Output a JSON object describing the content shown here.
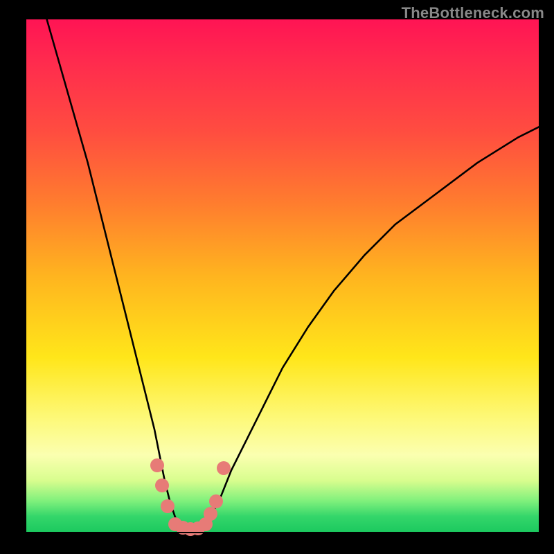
{
  "watermark": "TheBottleneck.com",
  "colors": {
    "curve": "#000000",
    "dot": "#e77b77",
    "plot_border": "#000000"
  },
  "chart_data": {
    "type": "line",
    "title": "",
    "xlabel": "",
    "ylabel": "",
    "xlim": [
      0,
      100
    ],
    "ylim": [
      0,
      100
    ],
    "grid": false,
    "legend": false,
    "series": [
      {
        "name": "bottleneck-curve",
        "x": [
          4,
          6,
          8,
          10,
          12,
          14,
          16,
          18,
          20,
          22,
          24,
          25,
          26,
          27,
          28,
          29,
          30,
          31,
          32,
          33,
          34,
          36,
          38,
          40,
          43,
          46,
          50,
          55,
          60,
          66,
          72,
          80,
          88,
          96,
          100
        ],
        "y": [
          100,
          93,
          86,
          79,
          72,
          64,
          56,
          48,
          40,
          32,
          24,
          20,
          15,
          10,
          6,
          3,
          1,
          0.6,
          0.5,
          0.5,
          1,
          3,
          7,
          12,
          18,
          24,
          32,
          40,
          47,
          54,
          60,
          66,
          72,
          77,
          79
        ]
      }
    ],
    "marker_points": {
      "name": "highlighted-dots",
      "points": [
        {
          "x": 25.5,
          "y": 13
        },
        {
          "x": 26.5,
          "y": 9
        },
        {
          "x": 27.5,
          "y": 5
        },
        {
          "x": 29.0,
          "y": 1.5
        },
        {
          "x": 30.5,
          "y": 0.8
        },
        {
          "x": 32.0,
          "y": 0.6
        },
        {
          "x": 33.5,
          "y": 0.7
        },
        {
          "x": 35.0,
          "y": 1.5
        },
        {
          "x": 36.0,
          "y": 3.5
        },
        {
          "x": 37.0,
          "y": 6.0
        },
        {
          "x": 38.5,
          "y": 12.5
        }
      ]
    }
  }
}
